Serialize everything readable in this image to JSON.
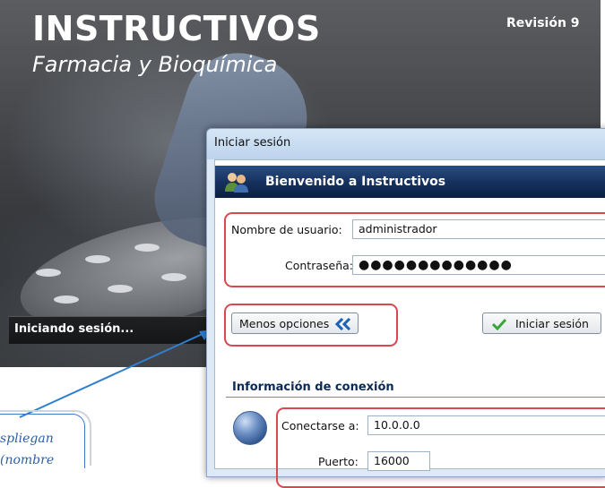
{
  "splash": {
    "title": "INSTRUCTIVOS",
    "subtitle": "Farmacia y Bioquímica",
    "revision": "Revisión 9",
    "status": "Iniciando sesión..."
  },
  "dialog": {
    "title": "Iniciar sesión",
    "banner": "Bienvenido a Instructivos",
    "username_label": "Nombre de usuario:",
    "username_value": "administrador",
    "password_label": "Contraseña:",
    "password_value": "●●●●●●●●●●●●●",
    "less_options_label": "Menos opciones",
    "login_button_label": "Iniciar sesión",
    "connection_heading": "Información de conexión",
    "connect_label": "Conectarse a:",
    "connect_value": "10.0.0.0",
    "port_label": "Puerto:",
    "port_value": "16000"
  },
  "callout": {
    "line1": "spliegan",
    "line2": "(nombre"
  },
  "colors": {
    "banner": "#14305c",
    "highlight_border": "#d9474f",
    "arrow": "#2f7fd1",
    "check": "#3aa63a"
  },
  "icons": [
    "users-icon",
    "double-chevron-left-icon",
    "checkmark-icon",
    "globe-icon"
  ]
}
